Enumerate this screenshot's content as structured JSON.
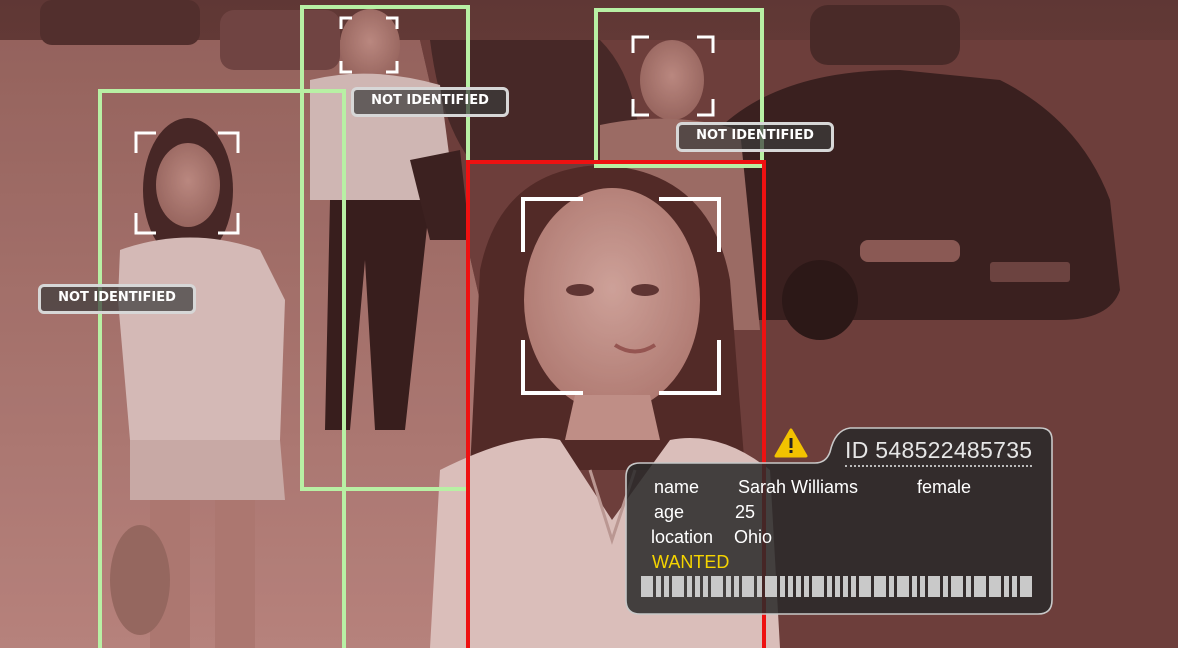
{
  "scene": {
    "background_tint": "#7a4540",
    "frame_color_ok": "#b8f0a4",
    "frame_color_alert": "#ee1111"
  },
  "labels": {
    "left_person": "NOT IDENTIFIED",
    "center_person": "NOT IDENTIFIED",
    "right_person": "NOT IDENTIFIED"
  },
  "alert_card": {
    "warning_icon": "warning-triangle-icon",
    "id_text": "ID 548522485735",
    "name_label": "name",
    "name_value": "Sarah Williams",
    "gender": "female",
    "age_label": "age",
    "age_value": "25",
    "location_label": "location",
    "location_value": "Ohio",
    "status": "WANTED",
    "status_color": "#f5d400"
  }
}
